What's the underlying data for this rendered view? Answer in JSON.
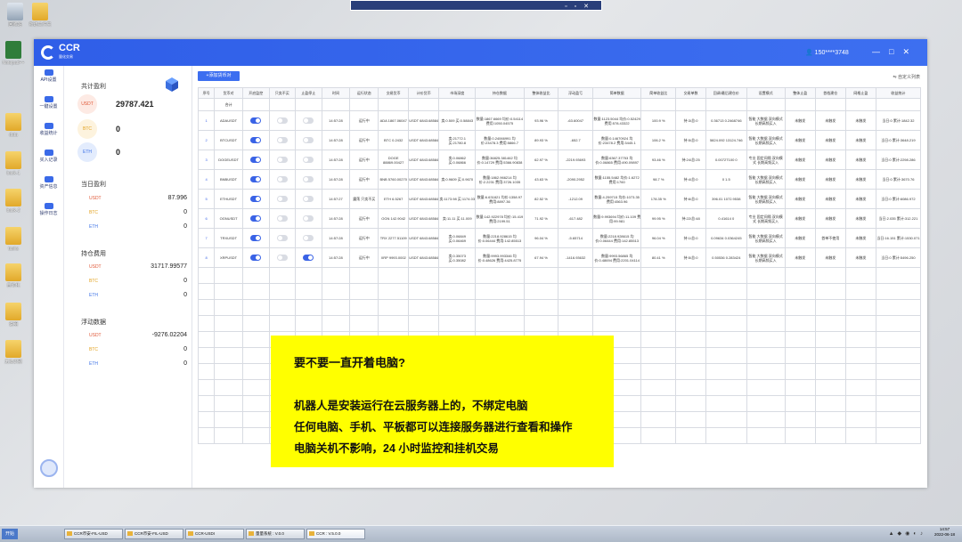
{
  "desktop": {
    "icons": [
      {
        "label": "回收站"
      },
      {
        "label": "新建文件夹"
      },
      {
        "label": "Notepad++"
      },
      {
        "label": "data"
      },
      {
        "label": "back-1"
      },
      {
        "label": "back-2"
      },
      {
        "label": "tasks"
      },
      {
        "label": "自动化"
      },
      {
        "label": "说明"
      },
      {
        "label": "无法识别"
      }
    ]
  },
  "window": {
    "logo_name": "CCR",
    "logo_sub": "量化交易",
    "user": "150****3748",
    "controls": [
      "—",
      "□",
      "✕"
    ]
  },
  "sidebar": {
    "items": [
      {
        "label": "API设置"
      },
      {
        "label": "一键设置"
      },
      {
        "label": "收益统计"
      },
      {
        "label": "买入记录"
      },
      {
        "label": "资产信息"
      },
      {
        "label": "操作日志"
      }
    ]
  },
  "panel": {
    "total_title": "共计盈利",
    "total_coin": "USDT",
    "total_value": "29787.421",
    "btc_label": "BTC",
    "btc_value": "0",
    "eth_label": "ETH",
    "eth_value": "0",
    "today_title": "当日盈利",
    "today": [
      {
        "coin": "USDT",
        "value": "87.996"
      },
      {
        "coin": "BTC",
        "value": "0"
      },
      {
        "coin": "ETH",
        "value": "0"
      }
    ],
    "hold_title": "持仓费用",
    "hold": [
      {
        "coin": "USDT",
        "value": "31717.99577"
      },
      {
        "coin": "BTC",
        "value": "0"
      },
      {
        "coin": "ETH",
        "value": "0"
      }
    ],
    "float_title": "浮动数据",
    "float": [
      {
        "coin": "USDT",
        "value": "-9276.02204"
      },
      {
        "coin": "BTC",
        "value": "0"
      },
      {
        "coin": "ETH",
        "value": "0"
      }
    ]
  },
  "main": {
    "add_button": "+添加货币对",
    "settings_link": "自定义列表",
    "headers": [
      "序号",
      "货币对",
      "开启监控",
      "只卖不买",
      "止盈停止",
      "时间",
      "运行状态",
      "交易货币",
      "计价货币",
      "市场深度",
      "持仓数据",
      "整体收益比",
      "浮动盈亏",
      "简单数据",
      "简单收益比",
      "交易单数",
      "回调/最后建仓价",
      "设置模式",
      "整体止盈",
      "首档建仓",
      "网格止盈",
      "收益统计"
    ],
    "subrow": "合计",
    "rows": [
      {
        "n": "1",
        "pair": "ADAUSDT",
        "mon": true,
        "sell": false,
        "stop": false,
        "time": "14:57:28",
        "status": "运行中",
        "coin": "ADA 1867.06047",
        "quote": "USDT 6843.68584",
        "depth": "卖:0.509 买:0.58843",
        "hold": "数量:1867.6669 均价:0.54114 费用:1050.04575",
        "ratio": "93.96 %",
        "float": "-63.60047",
        "simple": "数量:1123.5044 均价:0.52429 费用:578.43322",
        "sratio": "100.9 %",
        "orders": "持:3/总:0",
        "cb": "0.36713 0.2468746",
        "mode": "智能 大数据 双向模式 长期高频买入",
        "tp": "未触发",
        "first": "未触发",
        "grid": "未触发",
        "stat": "当日:0 累计:1842.32"
      },
      {
        "n": "2",
        "pair": "BTCUSDT",
        "mon": true,
        "sell": false,
        "stop": false,
        "time": "14:57:28",
        "status": "运行中",
        "coin": "BTC 0.2432",
        "quote": "USDT 6843.68584",
        "depth": "卖:21772.1 买:21780.8",
        "hold": "数量:0.24066991 均价:23478.3 费用:5866.7",
        "ratio": "89.93 %",
        "float": "-652.7",
        "simple": "数量:0.14670924 均价:23478.2 费用:3445.1",
        "sratio": "106.2 %",
        "orders": "持:5/总:0",
        "cb": "5824.092 13124.746",
        "mode": "智能 大数据 双向模式 长期高频买入",
        "tp": "未触发",
        "first": "未触发",
        "grid": "未触发",
        "stat": "当日:0 累计:3648.219"
      },
      {
        "n": "3",
        "pair": "DOGEUSDT",
        "mon": true,
        "sell": false,
        "stop": false,
        "time": "14:57:28",
        "status": "运行中",
        "coin": "DOGE 88869.00427",
        "quote": "USDT 6843.68584",
        "depth": "卖:0.06862 买:0.06866",
        "hold": "数量:36825.381462 均价:0.14729 费用:5366.90838",
        "ratio": "62.97 %",
        "float": "-2219.93693",
        "simple": "数量:6367.37753 均价:0.06865 费用:490.09897",
        "sratio": "93.46 %",
        "orders": "持:24/总:25",
        "cb": "0.0072T100 0",
        "mode": "专业 固定间隔 双向模式 长期高频买入",
        "tp": "未触发",
        "first": "未触发",
        "grid": "未触发",
        "stat": "当日:0 累计:2298.286"
      },
      {
        "n": "4",
        "pair": "BNBUSDT",
        "mon": true,
        "sell": false,
        "stop": false,
        "time": "14:57:28",
        "status": "运行中",
        "coin": "BNB 5760.00270",
        "quote": "USDT 6843.68584",
        "depth": "卖:0.9609 买:0.9670",
        "hold": "数量:1862.966214 均价:2.2231 费用:3726.1035",
        "ratio": "43.63 %",
        "float": "-2090.2952",
        "simple": "数量:1155.5482 均价:1.6272 费用:1760",
        "sratio": "98.7 %",
        "orders": "持:4/总:0",
        "cb": "0 1.5",
        "mode": "智能 大数据 双向模式 长期高频买入",
        "tp": "未触发",
        "first": "未触发",
        "grid": "未触发",
        "stat": "当日:0 累计:3670.76"
      },
      {
        "n": "5",
        "pair": "ETHUSDT",
        "mon": true,
        "sell": false,
        "stop": false,
        "time": "14:57:27",
        "status": "震荡 只卖不买",
        "coin": "ETH 6.5267",
        "quote": "USDT 6843.68584",
        "depth": "卖:1173.98 买:1174.03",
        "hold": "数量:6.631821 均价:1358.97 费用:8897.36",
        "ratio": "82.52 %",
        "float": "-1212.09",
        "simple": "数量:4.259715 均价:1073.35 费用:4563.96",
        "sratio": "178.35 %",
        "orders": "持:6/总:0",
        "cb": "396.01 1072.9538",
        "mode": "智能 大数据 双向模式 长期高频买入",
        "tp": "未触发",
        "first": "未触发",
        "grid": "未触发",
        "stat": "当日:0 累计:6086.972"
      },
      {
        "n": "6",
        "pair": "OGNUSDT",
        "mon": true,
        "sell": false,
        "stop": false,
        "time": "14:57:28",
        "status": "运行中",
        "coin": "OGN 142.9042",
        "quote": "USDT 6843.68584",
        "depth": "卖:11.11 买:11.009",
        "hold": "数量:142.922978 均价:15.419 费用:2199.51",
        "ratio": "71.92 %",
        "float": "-617.482",
        "simple": "数量:9.993694 均价:11.109 费用:99.981",
        "sratio": "99.95 %",
        "orders": "持:22/总:48",
        "cb": "0.41614 0",
        "mode": "专业 固定间隔 双向模式 长期高频买入",
        "tp": "未触发",
        "first": "未触发",
        "grid": "未触发",
        "stat": "当日:2.035 累计:312.221"
      },
      {
        "n": "7",
        "pair": "TRXUSDT",
        "mon": true,
        "sell": false,
        "stop": false,
        "time": "14:57:28",
        "status": "运行中",
        "coin": "TRX 2277.51109",
        "quote": "USDT 6843.68584",
        "depth": "卖:0.06849 买:0.06469",
        "hold": "数量:2218.928615 均价:0.06444 费用:142.85513",
        "ratio": "96.04 %",
        "float": "-5.65714",
        "simple": "数量:2218.928615 均价:0.06444 费用:142.85513",
        "sratio": "96.04 %",
        "orders": "持:1/总:0",
        "cb": "0.09634 0.0364245",
        "mode": "智能 大数据 双向模式 长期高频买入",
        "tp": "未触发",
        "first": "首单不使用",
        "grid": "未触发",
        "stat": "当日:16.151 累计:1530.071"
      },
      {
        "n": "8",
        "pair": "XRPUSDT",
        "mon": true,
        "sell": false,
        "stop": true,
        "time": "14:57:28",
        "status": "运行中",
        "coin": "XRP 9993.0002",
        "quote": "USDT 6843.68584",
        "depth": "卖:0.35073 买:0.35082",
        "hold": "数量:9993.993346 均价:0.48626 费用:4425.8775",
        "ratio": "67.94 %",
        "float": "-1416.93632",
        "simple": "数量:9993.56865 均价:0.48694 费用:2201.04114",
        "sratio": "80.41 %",
        "orders": "持:5/总:0",
        "cb": "0.50536 0.283424",
        "mode": "智能 大数据 双向模式 长期高频买入",
        "tp": "未触发",
        "first": "未触发",
        "grid": "未触发",
        "stat": "当日:0 累计:5496.250"
      }
    ]
  },
  "overlay": {
    "title": "要不要一直开着电脑?",
    "lines": [
      "机器人是安装运行在云服务器上的，不绑定电脑",
      "任何电脑、手机、平板都可以连接服务器进行查看和操作",
      "电脑关机不影响，24 小时监控和挂机交易"
    ]
  },
  "taskbar": {
    "start": "开始",
    "tasks": [
      "CCR币安-FIL-USD",
      "CCR币安-FIL-USD",
      "CCR-USDI",
      "量量系统 : V.0.0",
      "CCR : V.5.0.0"
    ],
    "time": "14:57",
    "date": "2022-06-18"
  }
}
